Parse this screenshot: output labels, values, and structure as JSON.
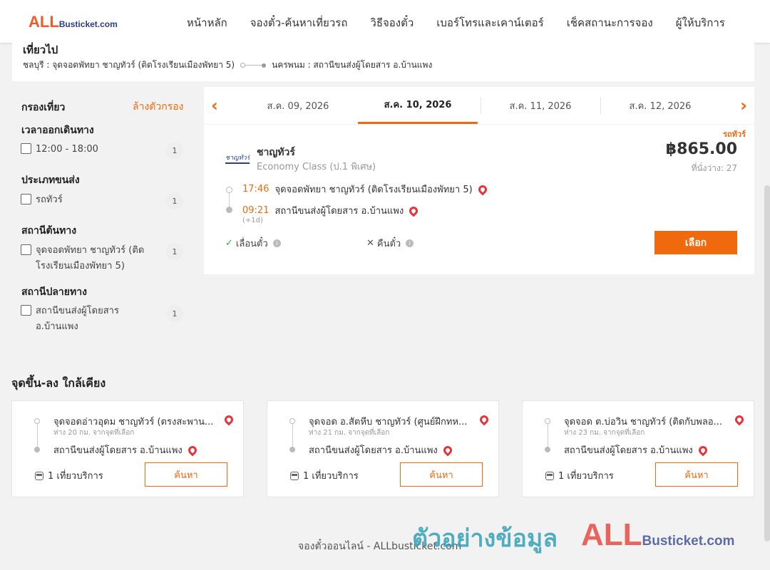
{
  "header": {
    "logo_big": "ALL",
    "logo_small": "Busticket.com",
    "nav": [
      "หน้าหลัก",
      "จองตั๋ว-ค้นหาเที่ยวรถ",
      "วิธีจองตั๋ว",
      "เบอร์โทรและเคาน์เตอร์",
      "เช็คสถานะการจอง",
      "ผู้ให้บริการ"
    ]
  },
  "trip": {
    "title": "เที่ยวไป",
    "origin": "ชลบุรี : จุดจอดพัทยา ชาญทัวร์ (ติดโรงเรียนเมืองพัทยา 5)",
    "destination": "นครพนม : สถานีขนส่งผู้โดยสาร อ.บ้านแพง"
  },
  "filter": {
    "heading": "กรองเที่ยว",
    "clear": "ล้างตัวกรอง",
    "sections": [
      {
        "title": "เวลาออกเดินทาง",
        "option": "12:00 - 18:00",
        "count": "1"
      },
      {
        "title": "ประเภทขนส่ง",
        "option": "รถทัวร์",
        "count": "1"
      },
      {
        "title": "สถานีต้นทาง",
        "option": "จุดจอดพัทยา ชาญทัวร์ (ติดโรงเรียนเมืองพัทยา 5)",
        "count": "1"
      },
      {
        "title": "สถานีปลายทาง",
        "option": "สถานีขนส่งผู้โดยสาร อ.บ้านแพง",
        "count": "1"
      }
    ]
  },
  "dates": {
    "tabs": [
      "ส.ค. 09, 2026",
      "ส.ค. 10, 2026",
      "ส.ค. 11, 2026",
      "ส.ค. 12, 2026"
    ],
    "active_index": 1
  },
  "result": {
    "vehicle_type": "รถทัวร์",
    "operator_logo_text": "ชาญทัวร์",
    "operator": "ชาญทัวร์",
    "class": "Economy Class (ป.1 พิเศษ)",
    "price": "฿865.00",
    "seats": "ที่นั่งว่าง: 27",
    "depart_time": "17:46",
    "depart_place": "จุดจอดพัทยา ชาญทัวร์ (ติดโรงเรียนเมืองพัทยา 5)",
    "arrive_time": "09:21",
    "arrive_place": "สถานีขนส่งผู้โดยสาร อ.บ้านแพง",
    "next_day": "(+1d)",
    "reschedule": "เลื่อนตั๋ว",
    "refund": "คืนตั๋ว",
    "select": "เลือก"
  },
  "nearby": {
    "title": "จุดขึ้น-ลง ใกล้เคียง",
    "cards": [
      {
        "from": "จุดจอดอ่าวอุดม ชาญทัวร์ (ตรงสะพาน...",
        "distance": "ห่าง 20 กม. จากจุดที่เลือก",
        "to": "สถานีขนส่งผู้โดยสาร อ.บ้านแพง",
        "trips": "1 เที่ยวบริการ",
        "search": "ค้นหา"
      },
      {
        "from": "จุดจอด อ.สัตหีบ ชาญทัวร์ (ศูนย์ฝึกทห...",
        "distance": "ห่าง 21 กม. จากจุดที่เลือก",
        "to": "สถานีขนส่งผู้โดยสาร อ.บ้านแพง",
        "trips": "1 เที่ยวบริการ",
        "search": "ค้นหา"
      },
      {
        "from": "จุดจอด ต.บ่อวิน ชาญทัวร์ (ติดกับพลอ...",
        "distance": "ห่าง 23 กม. จากจุดที่เลือก",
        "to": "สถานีขนส่งผู้โดยสาร อ.บ้านแพง",
        "trips": "1 เที่ยวบริการ",
        "search": "ค้นหา"
      }
    ]
  },
  "footer": {
    "text": "จองตั๋วออนไลน์ - ALLbusticket.com",
    "watermark": "ตัวอย่างข้อมูล",
    "watermark_logo_big": "ALL",
    "watermark_logo_small": "Busticket.com"
  },
  "colors": {
    "accent": "#f06a0d",
    "brand_red": "#f05a28",
    "brand_blue": "#2a3e8c",
    "pin_red": "#e7343a",
    "check_green": "#2ba84a"
  }
}
